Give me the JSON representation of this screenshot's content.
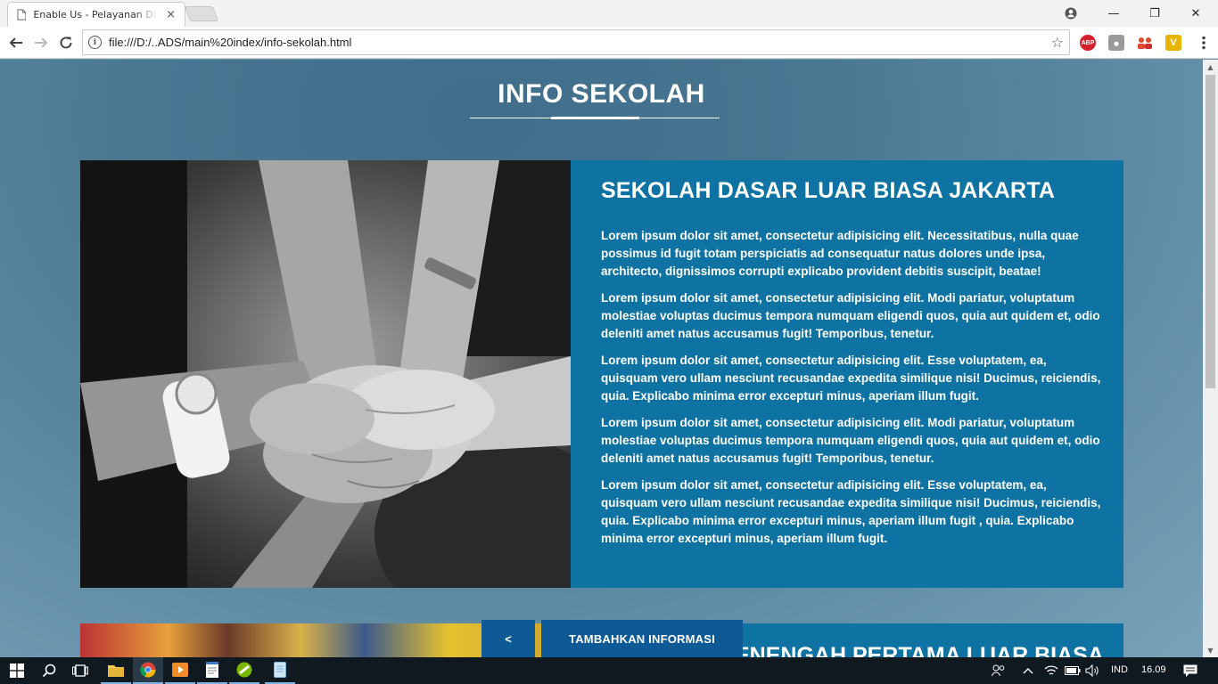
{
  "browser": {
    "tab_title": "Enable Us - Pelayanan Disabilitas",
    "tab_close": "×",
    "url": "file:///D:/..ADS/main%20index/info-sekolah.html",
    "back_icon": "arrow-left-icon",
    "forward_icon": "arrow-right-icon",
    "reload_icon": "reload-icon",
    "bookmark_icon": "star-icon",
    "extensions": [
      {
        "name": "adblock-plus-icon",
        "label": "ABP",
        "color": "#d6202b"
      },
      {
        "name": "camera-icon",
        "label": "",
        "color": "#9a9a9a"
      },
      {
        "name": "people-icon",
        "label": "",
        "color": "#e04a2a"
      },
      {
        "name": "v-extension-icon",
        "label": "V",
        "color": "#e8b400"
      }
    ],
    "window_controls": {
      "minimize": "—",
      "restore": "❐",
      "close": "✕"
    }
  },
  "page": {
    "title": "INFO SEKOLAH",
    "school1": {
      "name": "SEKOLAH DASAR LUAR BIASA JAKARTA",
      "paragraphs": [
        "Lorem ipsum dolor sit amet, consectetur adipisicing elit. Necessitatibus, nulla quae possimus id fugit totam perspiciatis ad consequatur natus dolores unde ipsa, architecto, dignissimos corrupti explicabo provident debitis suscipit, beatae!",
        "Lorem ipsum dolor sit amet, consectetur adipisicing elit. Modi pariatur, voluptatum molestiae voluptas ducimus tempora numquam eligendi quos, quia aut quidem et, odio deleniti amet natus accusamus fugit! Temporibus, tenetur.",
        "Lorem ipsum dolor sit amet, consectetur adipisicing elit. Esse voluptatem, ea, quisquam vero ullam nesciunt recusandae expedita similique nisi! Ducimus, reiciendis, quia. Explicabo minima error excepturi minus, aperiam illum fugit.",
        "Lorem ipsum dolor sit amet, consectetur adipisicing elit. Modi pariatur, voluptatum molestiae voluptas ducimus tempora numquam eligendi quos, quia aut quidem et, odio deleniti amet natus accusamus fugit! Temporibus, tenetur.",
        "Lorem ipsum dolor sit amet, consectetur adipisicing elit. Esse voluptatem, ea, quisquam vero ullam nesciunt recusandae expedita similique nisi! Ducimus, reiciendis, quia. Explicabo minima error excepturi minus, aperiam illum fugit , quia. Explicabo minima error excepturi minus, aperiam illum fugit."
      ]
    },
    "school2": {
      "name": "SEKOLAH MENENGAH PERTAMA LUAR BIASA"
    },
    "buttons": {
      "prev": "<",
      "add_info": "TAMBAHKAN INFORMASI"
    }
  },
  "taskbar": {
    "language": "IND",
    "time": "16.09",
    "apps": [
      "start-icon",
      "search-icon",
      "task-view-icon",
      "file-explorer-icon",
      "chrome-icon",
      "media-player-icon",
      "notepad-icon",
      "app-icon",
      "notes-icon"
    ]
  }
}
